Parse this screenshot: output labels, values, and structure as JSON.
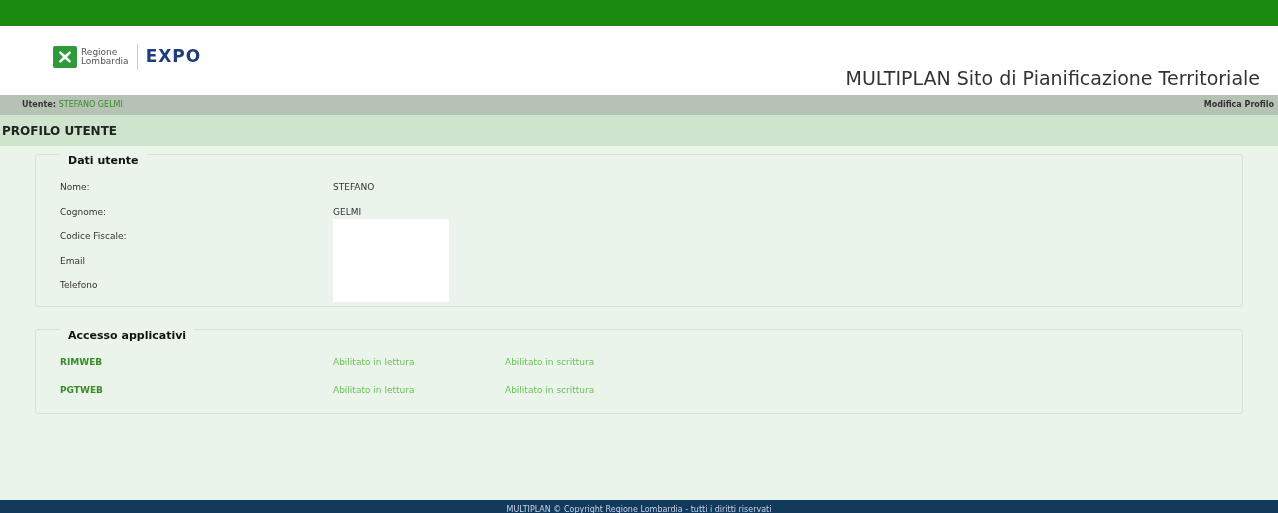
{
  "header": {
    "logo_lines": [
      "Regione",
      "Lombardia"
    ],
    "expo": "EXPO",
    "site_title": "MULTIPLAN Sito di Pianificazione Territoriale"
  },
  "user_bar": {
    "label": "Utente:",
    "user": "STEFANO GELMI",
    "link": "Modifica Profilo"
  },
  "page_title": "PROFILO UTENTE",
  "user_data": {
    "legend": "Dati utente",
    "fields": [
      {
        "label": "Nome:",
        "value": "STEFANO"
      },
      {
        "label": "Cognome:",
        "value": "GELMI"
      },
      {
        "label": "Codice Fiscale:",
        "kind": "hidden"
      },
      {
        "label": "Email",
        "kind": "hidden"
      },
      {
        "label": "Telefono",
        "kind": "hidden"
      }
    ]
  },
  "app_access": {
    "legend": "Accesso applicativi",
    "apps": [
      {
        "name": "RIMWEB",
        "read": "Abilitato in lettura",
        "write": "Abilitato in scrittura"
      },
      {
        "name": "PGTWEB",
        "read": "Abilitato in lettura",
        "write": "Abilitato in scrittura"
      }
    ]
  },
  "footer": "MULTIPLAN © Copyright Regione Lombardia - tutti i diritti riservati"
}
